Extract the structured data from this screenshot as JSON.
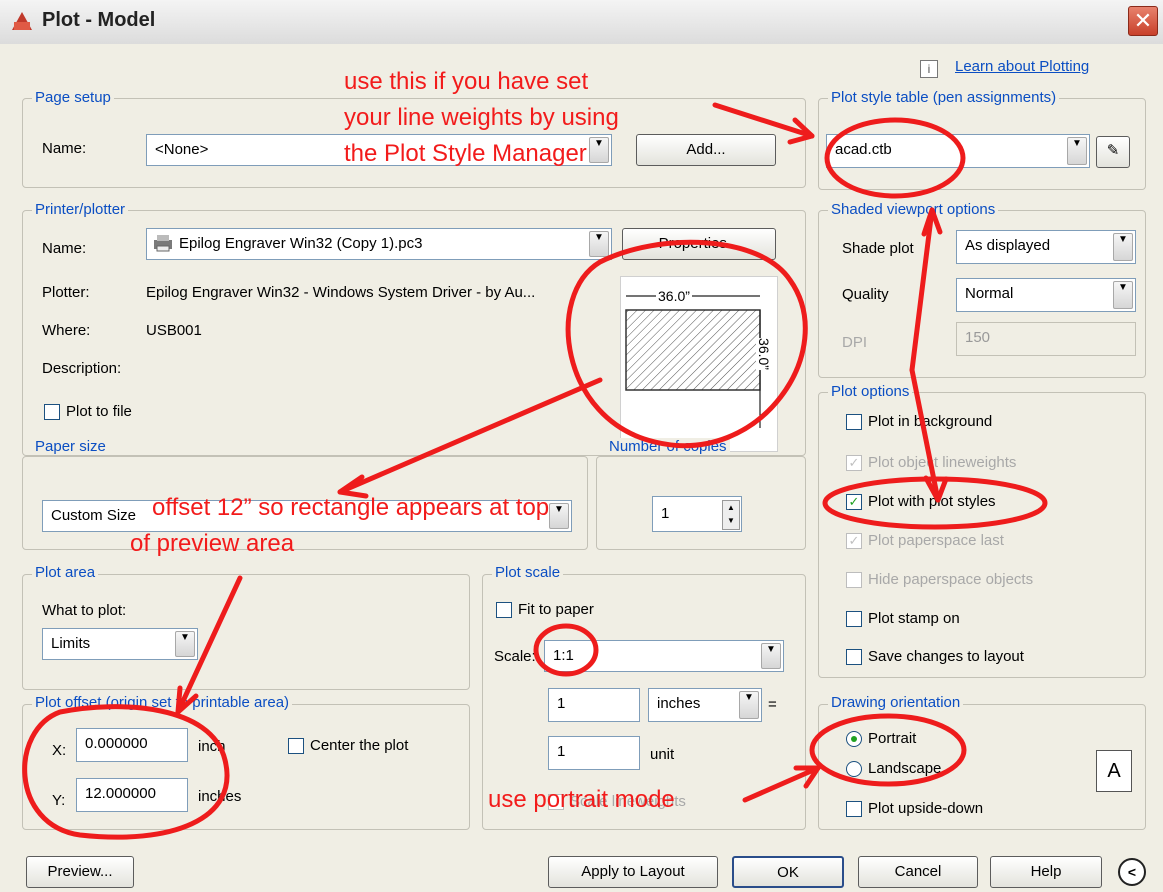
{
  "window": {
    "title": "Plot - Model"
  },
  "help_link": "Learn about Plotting",
  "page_setup": {
    "title": "Page setup",
    "name_label": "Name:",
    "name_value": "<None>",
    "add_button": "Add..."
  },
  "printer": {
    "title": "Printer/plotter",
    "name_label": "Name:",
    "name_value": "Epilog Engraver Win32 (Copy 1).pc3",
    "properties_button": "Properties...",
    "plotter_label": "Plotter:",
    "plotter_value": "Epilog Engraver Win32 - Windows System Driver - by Au...",
    "where_label": "Where:",
    "where_value": "USB001",
    "description_label": "Description:",
    "plot_to_file": "Plot to file",
    "preview_width": "36.0”",
    "preview_height": "36.0”"
  },
  "paper_size": {
    "title": "Paper size",
    "value": "Custom Size"
  },
  "copies": {
    "title": "Number of copies",
    "value": "1"
  },
  "plot_area": {
    "title": "Plot area",
    "what_label": "What to plot:",
    "what_value": "Limits"
  },
  "plot_offset": {
    "title": "Plot offset (origin set to printable area)",
    "x_label": "X:",
    "x_value": "0.000000",
    "x_unit": "inch",
    "y_label": "Y:",
    "y_value": "12.000000",
    "y_unit": "inches",
    "center": "Center the plot"
  },
  "plot_scale": {
    "title": "Plot scale",
    "fit": "Fit to paper",
    "scale_label": "Scale:",
    "scale_value": "1:1",
    "num_value": "1",
    "num_unit": "inches",
    "equals": "=",
    "den_value": "1",
    "den_unit": "unit",
    "lineweights": "Scale lineweights"
  },
  "plot_style_table": {
    "title": "Plot style table (pen assignments)",
    "value": "acad.ctb"
  },
  "shaded": {
    "title": "Shaded viewport options",
    "shade_label": "Shade plot",
    "shade_value": "As displayed",
    "quality_label": "Quality",
    "quality_value": "Normal",
    "dpi_label": "DPI",
    "dpi_value": "150"
  },
  "plot_options": {
    "title": "Plot options",
    "items": [
      "Plot in background",
      "Plot object lineweights",
      "Plot with plot styles",
      "Plot paperspace last",
      "Hide paperspace objects",
      "Plot stamp on",
      "Save changes to layout"
    ]
  },
  "orientation": {
    "title": "Drawing orientation",
    "portrait": "Portrait",
    "landscape": "Landscape",
    "upside": "Plot upside-down",
    "icon_letter": "A"
  },
  "buttons": {
    "preview": "Preview...",
    "apply": "Apply to Layout",
    "ok": "OK",
    "cancel": "Cancel",
    "help": "Help"
  },
  "annotations": {
    "line1": "use this if you have set",
    "line2": "your line weights by using",
    "line3": "the Plot Style Manager",
    "offset1": "offset 12” so rectangle appears at top",
    "offset2": "of preview area",
    "portrait": "use portrait mode"
  }
}
